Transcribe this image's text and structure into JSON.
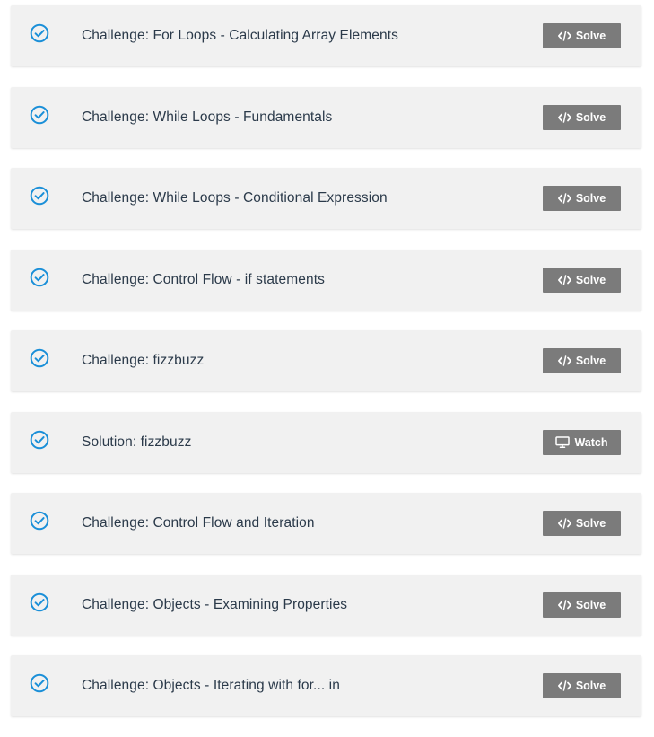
{
  "colors": {
    "card_background": "#f1f1f1",
    "check_icon": "#1a8fd8",
    "button_background": "#7b7b7b",
    "button_text": "#ffffff",
    "title_text": "#2b3a4a"
  },
  "items": [
    {
      "title": "Challenge: For Loops - Calculating Array Elements",
      "status_icon": "check-circle-icon",
      "action": {
        "label": "Solve",
        "icon": "code-icon"
      }
    },
    {
      "title": "Challenge: While Loops - Fundamentals",
      "status_icon": "check-circle-icon",
      "action": {
        "label": "Solve",
        "icon": "code-icon"
      }
    },
    {
      "title": "Challenge: While Loops - Conditional Expression",
      "status_icon": "check-circle-icon",
      "action": {
        "label": "Solve",
        "icon": "code-icon"
      }
    },
    {
      "title": "Challenge: Control Flow - if statements",
      "status_icon": "check-circle-icon",
      "action": {
        "label": "Solve",
        "icon": "code-icon"
      }
    },
    {
      "title": "Challenge: fizzbuzz",
      "status_icon": "check-circle-icon",
      "action": {
        "label": "Solve",
        "icon": "code-icon"
      }
    },
    {
      "title": "Solution: fizzbuzz",
      "status_icon": "check-circle-icon",
      "action": {
        "label": "Watch",
        "icon": "monitor-icon"
      }
    },
    {
      "title": "Challenge: Control Flow and Iteration",
      "status_icon": "check-circle-icon",
      "action": {
        "label": "Solve",
        "icon": "code-icon"
      }
    },
    {
      "title": "Challenge: Objects - Examining Properties",
      "status_icon": "check-circle-icon",
      "action": {
        "label": "Solve",
        "icon": "code-icon"
      }
    },
    {
      "title": "Challenge: Objects - Iterating with for... in",
      "status_icon": "check-circle-icon",
      "action": {
        "label": "Solve",
        "icon": "code-icon"
      }
    }
  ]
}
